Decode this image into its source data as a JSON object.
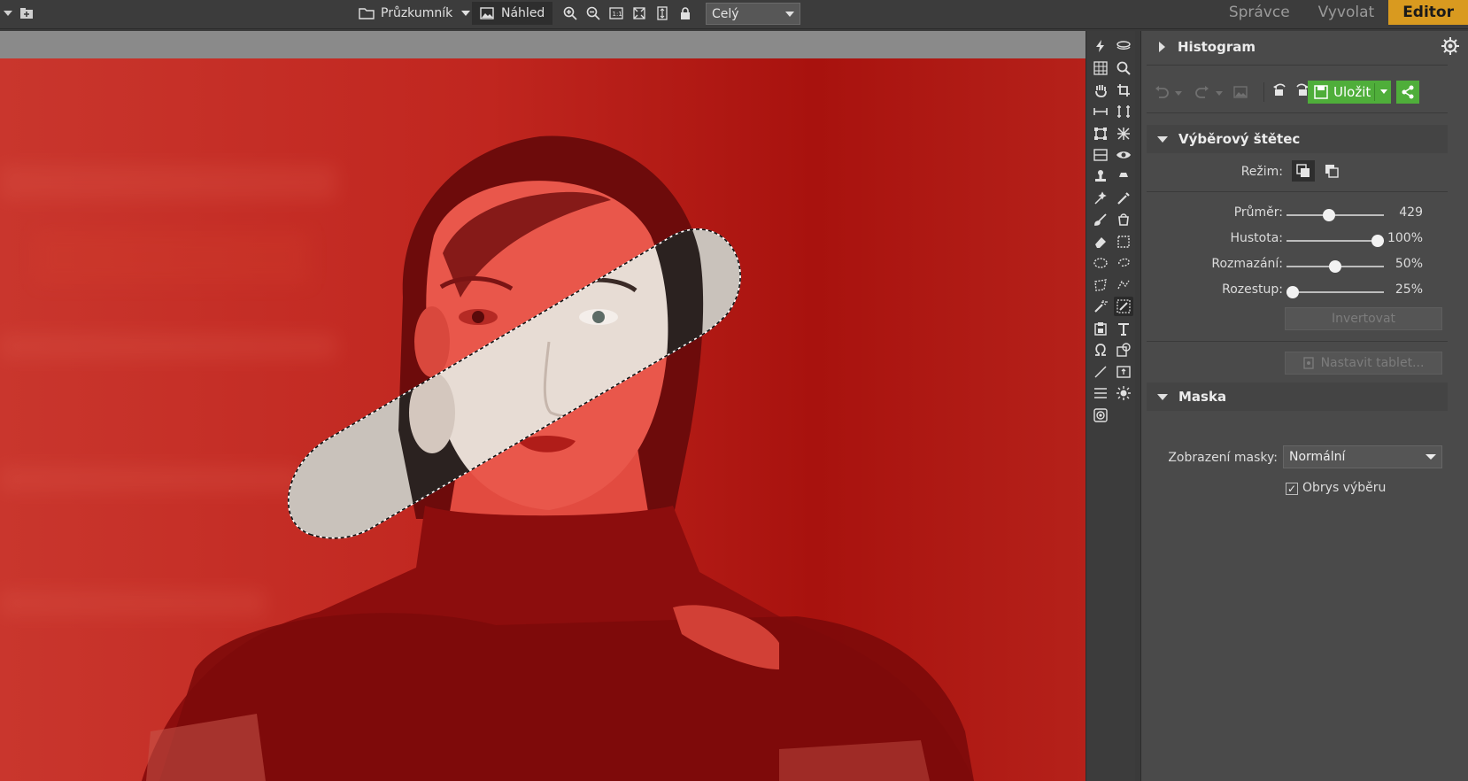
{
  "topbar": {
    "explorer_label": "Průzkumník",
    "preview_label": "Náhled",
    "zoom_value": "Celý"
  },
  "nav_tabs": [
    {
      "label": "Správce",
      "active": false
    },
    {
      "label": "Vyvolat",
      "active": false
    },
    {
      "label": "Editor",
      "active": true
    }
  ],
  "panel": {
    "histogram_title": "Histogram",
    "save_label": "Uložit",
    "brush_title": "Výběrový štětec",
    "mode_label": "Režim:",
    "sliders": [
      {
        "label": "Průměr:",
        "value_text": "429",
        "fraction": 0.43
      },
      {
        "label": "Hustota:",
        "value_text": "100%",
        "fraction": 1.0
      },
      {
        "label": "Rozmazání:",
        "value_text": "50%",
        "fraction": 0.5
      },
      {
        "label": "Rozestup:",
        "value_text": "25%",
        "fraction": 0.0
      }
    ],
    "invert_label": "Invertovat",
    "tablet_label": "Nastavit tablet...",
    "mask_title": "Maska",
    "mask_view_label": "Zobrazení masky:",
    "mask_view_value": "Normální",
    "outline_label": "Obrys výběru",
    "outline_checked": true
  },
  "colors": {
    "accent": "#d99a1f",
    "save_green": "#4fae3a",
    "mask_red": "#d42a24"
  },
  "icons": {
    "tools_left": [
      "bolt-icon",
      "grid-icon",
      "hand-icon",
      "measure-icon",
      "transform-icon",
      "gradient-icon",
      "stamp-icon",
      "brush-wand-icon",
      "brush-icon",
      "eraser-icon",
      "ellipse-select-icon",
      "poly-select-icon",
      "magic-wand-icon",
      "clipboard-icon",
      "omega-icon",
      "line-icon",
      "lines-icon",
      "lens-icon"
    ],
    "tools_right": [
      "layers-icon",
      "zoom-icon",
      "crop-icon",
      "straighten-icon",
      "perspective-icon",
      "eye-icon",
      "smudge-icon",
      "heal-icon",
      "bucket-icon",
      "rect-select-icon",
      "lasso-icon",
      "magnetic-lasso-icon",
      "selection-brush-icon",
      "text-icon",
      "shape-icon",
      "frame-icon",
      "sun-icon"
    ]
  }
}
